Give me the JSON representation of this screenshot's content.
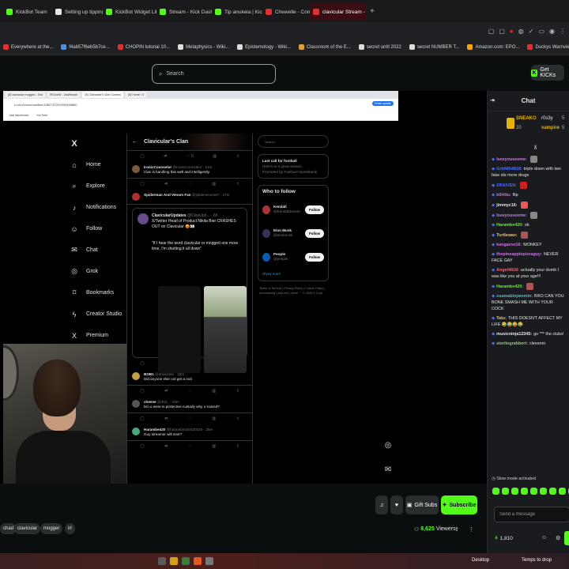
{
  "tabs": [
    {
      "label": "KickBot Team",
      "color": "#53fc18"
    },
    {
      "label": "Setting up tipping | KickB",
      "color": "#e5e5e5"
    },
    {
      "label": "KickBot Widget Library",
      "color": "#53fc18"
    },
    {
      "label": "Stream - Kick Dashboard",
      "color": "#53fc18"
    },
    {
      "label": "Tip anukeia | KickBot",
      "color": "#53fc18"
    },
    {
      "label": "Chewelle - Comfortable L",
      "color": "#e03030"
    },
    {
      "label": "clavicular Stream - Y",
      "color": "#e03030",
      "active": true
    }
  ],
  "bookmarks": [
    {
      "label": "Everywhere at the...",
      "color": "#e03030"
    },
    {
      "label": "f4ab57f6eb5b7ce...",
      "color": "#4a90e2"
    },
    {
      "label": "CHOPIN tutorial 10...",
      "color": "#e03030"
    },
    {
      "label": "Metaphysics - Wiki...",
      "color": "#ddd"
    },
    {
      "label": "Epistemology - Wiki...",
      "color": "#ddd"
    },
    {
      "label": "Classroom of the E...",
      "color": "#e0a030"
    },
    {
      "label": "secret until 2022",
      "color": "#ddd"
    },
    {
      "label": "secret NUMBER T...",
      "color": "#ddd"
    },
    {
      "label": "Amazon.com: EPO...",
      "color": "#ffa500"
    },
    {
      "label": "Duckys Warnvie...",
      "color": "#e03030"
    },
    {
      "label": "Rotten Winged Sw...",
      "color": "#e03030"
    },
    {
      "label": "Green Turtle Talis...",
      "color": "#e03030"
    }
  ],
  "search": {
    "placeholder": "Search"
  },
  "get_kicks": "Get KICKs",
  "x_window": {
    "tabs": [
      "(8) clavicular mogged - Sea",
      "IRCbotW - Dashboard",
      "(8) Clavicular's Clan Commu",
      "(5) Home / X"
    ],
    "url": "x.com/i/communities/1982797202593468860",
    "finish_update": "Finish update",
    "bookmarks": [
      "kick dashboard",
      "YouTube"
    ],
    "nav": [
      {
        "label": "Home",
        "icon": "home-icon",
        "glyph": "⌂"
      },
      {
        "label": "Explore",
        "icon": "search-icon",
        "glyph": "⌕"
      },
      {
        "label": "Notifications",
        "icon": "bell-icon",
        "glyph": "♪"
      },
      {
        "label": "Follow",
        "icon": "person-icon",
        "glyph": "☺"
      },
      {
        "label": "Chat",
        "icon": "mail-icon",
        "glyph": "✉"
      },
      {
        "label": "Grok",
        "icon": "grok-icon",
        "glyph": "◎"
      },
      {
        "label": "Bookmarks",
        "icon": "bookmark-icon",
        "glyph": "⌑"
      },
      {
        "label": "Creator Studio",
        "icon": "lightning-icon",
        "glyph": "ϟ"
      },
      {
        "label": "Premium",
        "icon": "x-icon",
        "glyph": "X"
      }
    ],
    "clan_title": "Clavicular's Clan",
    "tweets": [
      {
        "name": "IronicCounselor",
        "handle": "@IronicCounselor · 21m",
        "text": "Clav is handling this well and intelligently.",
        "color": "#7a5a3a"
      },
      {
        "name": "Spiderman And Venom Fan",
        "handle": "@spidevenom67 · 27m",
        "text": "",
        "color": "#b03030"
      }
    ],
    "quote": {
      "name": "ClavicularUpdates",
      "handle": "@ClavUpd... · 6h",
      "text": "X/Twitter Head of Product Nikita Bier CRASHES OUT on Clavicular 😡👀",
      "quote": "\"If I hear the word clavicular or mogged one more time, I'm shutting it all down\""
    },
    "tweets2": [
      {
        "name": "BOB1",
        "handle": "@shawnlan · 22m",
        "text": "Did anyone else not get a noti",
        "color": "#c0a040"
      },
      {
        "name": "cheese",
        "handle": "@dmt_ · 23m",
        "text": "bro u were in protective custody why u scared?",
        "color": "#555"
      },
      {
        "name": "Harambe420",
        "handle": "@harambe420420420 · 25m",
        "text": "Guy streamer will next?",
        "color": "#4a7"
      }
    ],
    "right": {
      "search_placeholder": "Search",
      "promo_title": "Last call for football",
      "promo_sub": "Here's to a great season",
      "promo_by": "Promoted by FanDuel Sportsbook",
      "wtf_title": "Who to follow",
      "follow": [
        {
          "name": "Kendall",
          "handle": "@KendallJenner",
          "color": "#a33"
        },
        {
          "name": "Elon Musk",
          "handle": "@elonmusk",
          "color": "#335"
        },
        {
          "name": "People",
          "handle": "@people",
          "color": "#0a5db0"
        }
      ],
      "follow_label": "Follow",
      "show_more": "Show more",
      "footer": "Terms of Service | Privacy Policy | Cookie Policy | Accessibility | Ads info | More ··· © 2025 X Corp."
    }
  },
  "chat": {
    "title": "Chat",
    "gifters": [
      {
        "name": "SNEAKO",
        "count": "20"
      },
      {
        "name": "r0s3y",
        "count": "5"
      },
      {
        "name": "vampire",
        "count": "5"
      }
    ],
    "messages": [
      {
        "user": "Iseeyouseeme:",
        "text": "",
        "color": "#c678dd",
        "emote": "#888"
      },
      {
        "user": "GrbNRi4818:",
        "text": "triple down with two fake ids more drugs",
        "color": "#4a6cff"
      },
      {
        "user": "XRAIVEN:",
        "text": "",
        "color": "#4a6cff",
        "emote": "#c22"
      },
      {
        "user": "b0rtitu:",
        "text": "flip",
        "color": "#c678dd"
      },
      {
        "user": "jimmyc16:",
        "text": "",
        "color": "#e6e6e6",
        "emote": "#e55"
      },
      {
        "user": "Iseeyouseeme:",
        "text": "",
        "color": "#c678dd",
        "emote": "#888"
      },
      {
        "user": "Harambe420:",
        "text": "ok",
        "color": "#53fc18"
      },
      {
        "user": "Turtlewax:",
        "text": "",
        "color": "#e5c07b",
        "emote": "#a55"
      },
      {
        "user": "kangaroo16:",
        "text": "MONKEY",
        "color": "#c678dd"
      },
      {
        "user": "thepineapplepizzaguy:",
        "text": "NEVER FACE GAY",
        "color": "#c678dd"
      },
      {
        "user": "Angel4818:",
        "text": "actually your dumb I was like you at your age!!!",
        "color": "#e06c75"
      },
      {
        "user": "Harambe420:",
        "text": "",
        "color": "#53fc18",
        "emote": "#a55"
      },
      {
        "user": "osamabinjammin:",
        "text": "BRO CAN YOU BONE SMASH ME WITH YOUR COCK",
        "color": "#56b6c2"
      },
      {
        "user": "Tatu:",
        "text": "THIS DOESN'T AFFECT MY LIFE 😂😂😂😂",
        "color": "#e5c07b"
      },
      {
        "user": "musicninja12345:",
        "text": "go *** the clubs!",
        "color": "#e6e6e6"
      },
      {
        "user": "sterlingrabbert:",
        "text": "clevenm",
        "color": "#98c379"
      }
    ],
    "slow_mode": "Slow mode activated",
    "input_placeholder": "Send a message",
    "points": "1,810"
  },
  "controls": {
    "gift_subs": "Gift Subs",
    "subscribe": "Subscribe",
    "tags": [
      "chad",
      "clavicular",
      "mogger",
      "irl"
    ],
    "viewers_count": "8,625",
    "viewers_label": "Viewers"
  },
  "taskbar": {
    "desktop": "Desktop",
    "weather": "Temps to drop"
  }
}
